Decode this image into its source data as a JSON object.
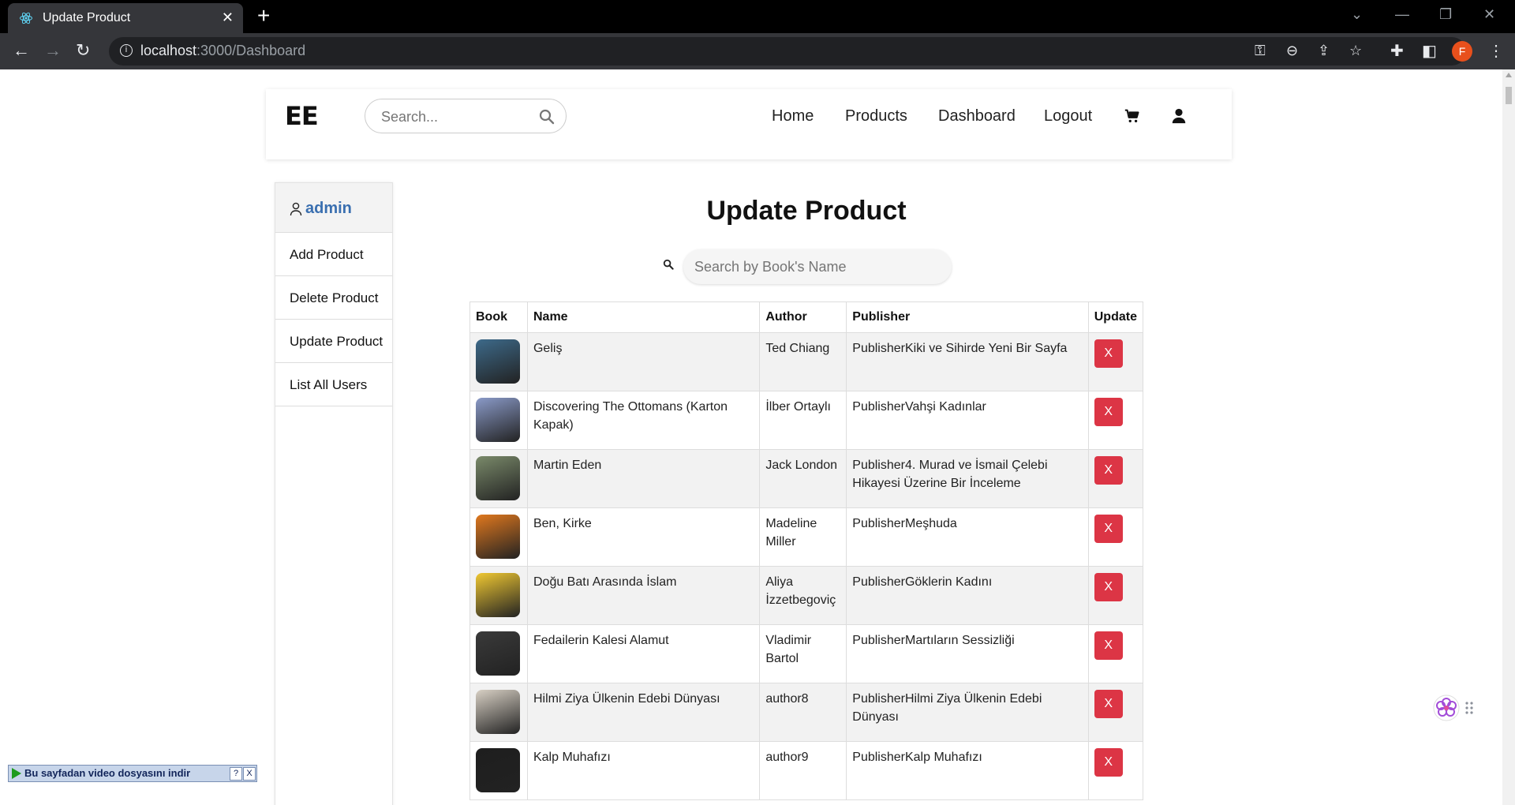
{
  "browser": {
    "tab_title": "Update Product",
    "tab_close": "✕",
    "new_tab": "+",
    "url_host": "localhost",
    "url_rest": ":3000/Dashboard",
    "profile_initial": "F"
  },
  "site": {
    "brand": "EE",
    "search_placeholder": "Search...",
    "nav": [
      "Home",
      "Products",
      "Dashboard",
      "Logout"
    ]
  },
  "sidebar": {
    "user": "admin",
    "items": [
      "Add Product",
      "Delete Product",
      "Update Product",
      "List All Users"
    ]
  },
  "main": {
    "title": "Update Product",
    "search_placeholder": "Search by Book's Name"
  },
  "table": {
    "headers": [
      "Book",
      "Name",
      "Author",
      "Publisher",
      "Update"
    ],
    "button_label": "X",
    "rows": [
      {
        "name": "Geliş",
        "author": "Ted Chiang",
        "publisher": "PublisherKiki ve Sihirde Yeni Bir Sayfa",
        "cover": "#3d6a8a"
      },
      {
        "name": "Discovering The Ottomans (Karton Kapak)",
        "author": "İlber Ortaylı",
        "publisher": "PublisherVahşi Kadınlar",
        "cover": "#8a9ac8"
      },
      {
        "name": "Martin Eden",
        "author": "Jack London",
        "publisher": "Publisher4. Murad ve İsmail Çelebi Hikayesi Üzerine Bir İnceleme",
        "cover": "#7a8a6a"
      },
      {
        "name": "Ben, Kirke",
        "author": "Madeline Miller",
        "publisher": "PublisherMeşhuda",
        "cover": "#e0781e"
      },
      {
        "name": "Doğu Batı Arasında İslam",
        "author": "Aliya İzzetbegoviç",
        "publisher": "PublisherGöklerin Kadını",
        "cover": "#f0c832"
      },
      {
        "name": "Fedailerin Kalesi Alamut",
        "author": "Vladimir Bartol",
        "publisher": "PublisherMartıların Sessizliği",
        "cover": "#3a3a3a"
      },
      {
        "name": "Hilmi Ziya Ülkenin Edebi Dünyası",
        "author": "author8",
        "publisher": "PublisherHilmi Ziya Ülkenin Edebi Dünyası",
        "cover": "#d8d0c4"
      },
      {
        "name": "Kalp Muhafızı",
        "author": "author9",
        "publisher": "PublisherKalp Muhafızı",
        "cover": "#1e1e1e"
      }
    ]
  },
  "download_bar": {
    "text": "Bu sayfadan video dosyasını indir",
    "help": "?",
    "close": "X"
  }
}
